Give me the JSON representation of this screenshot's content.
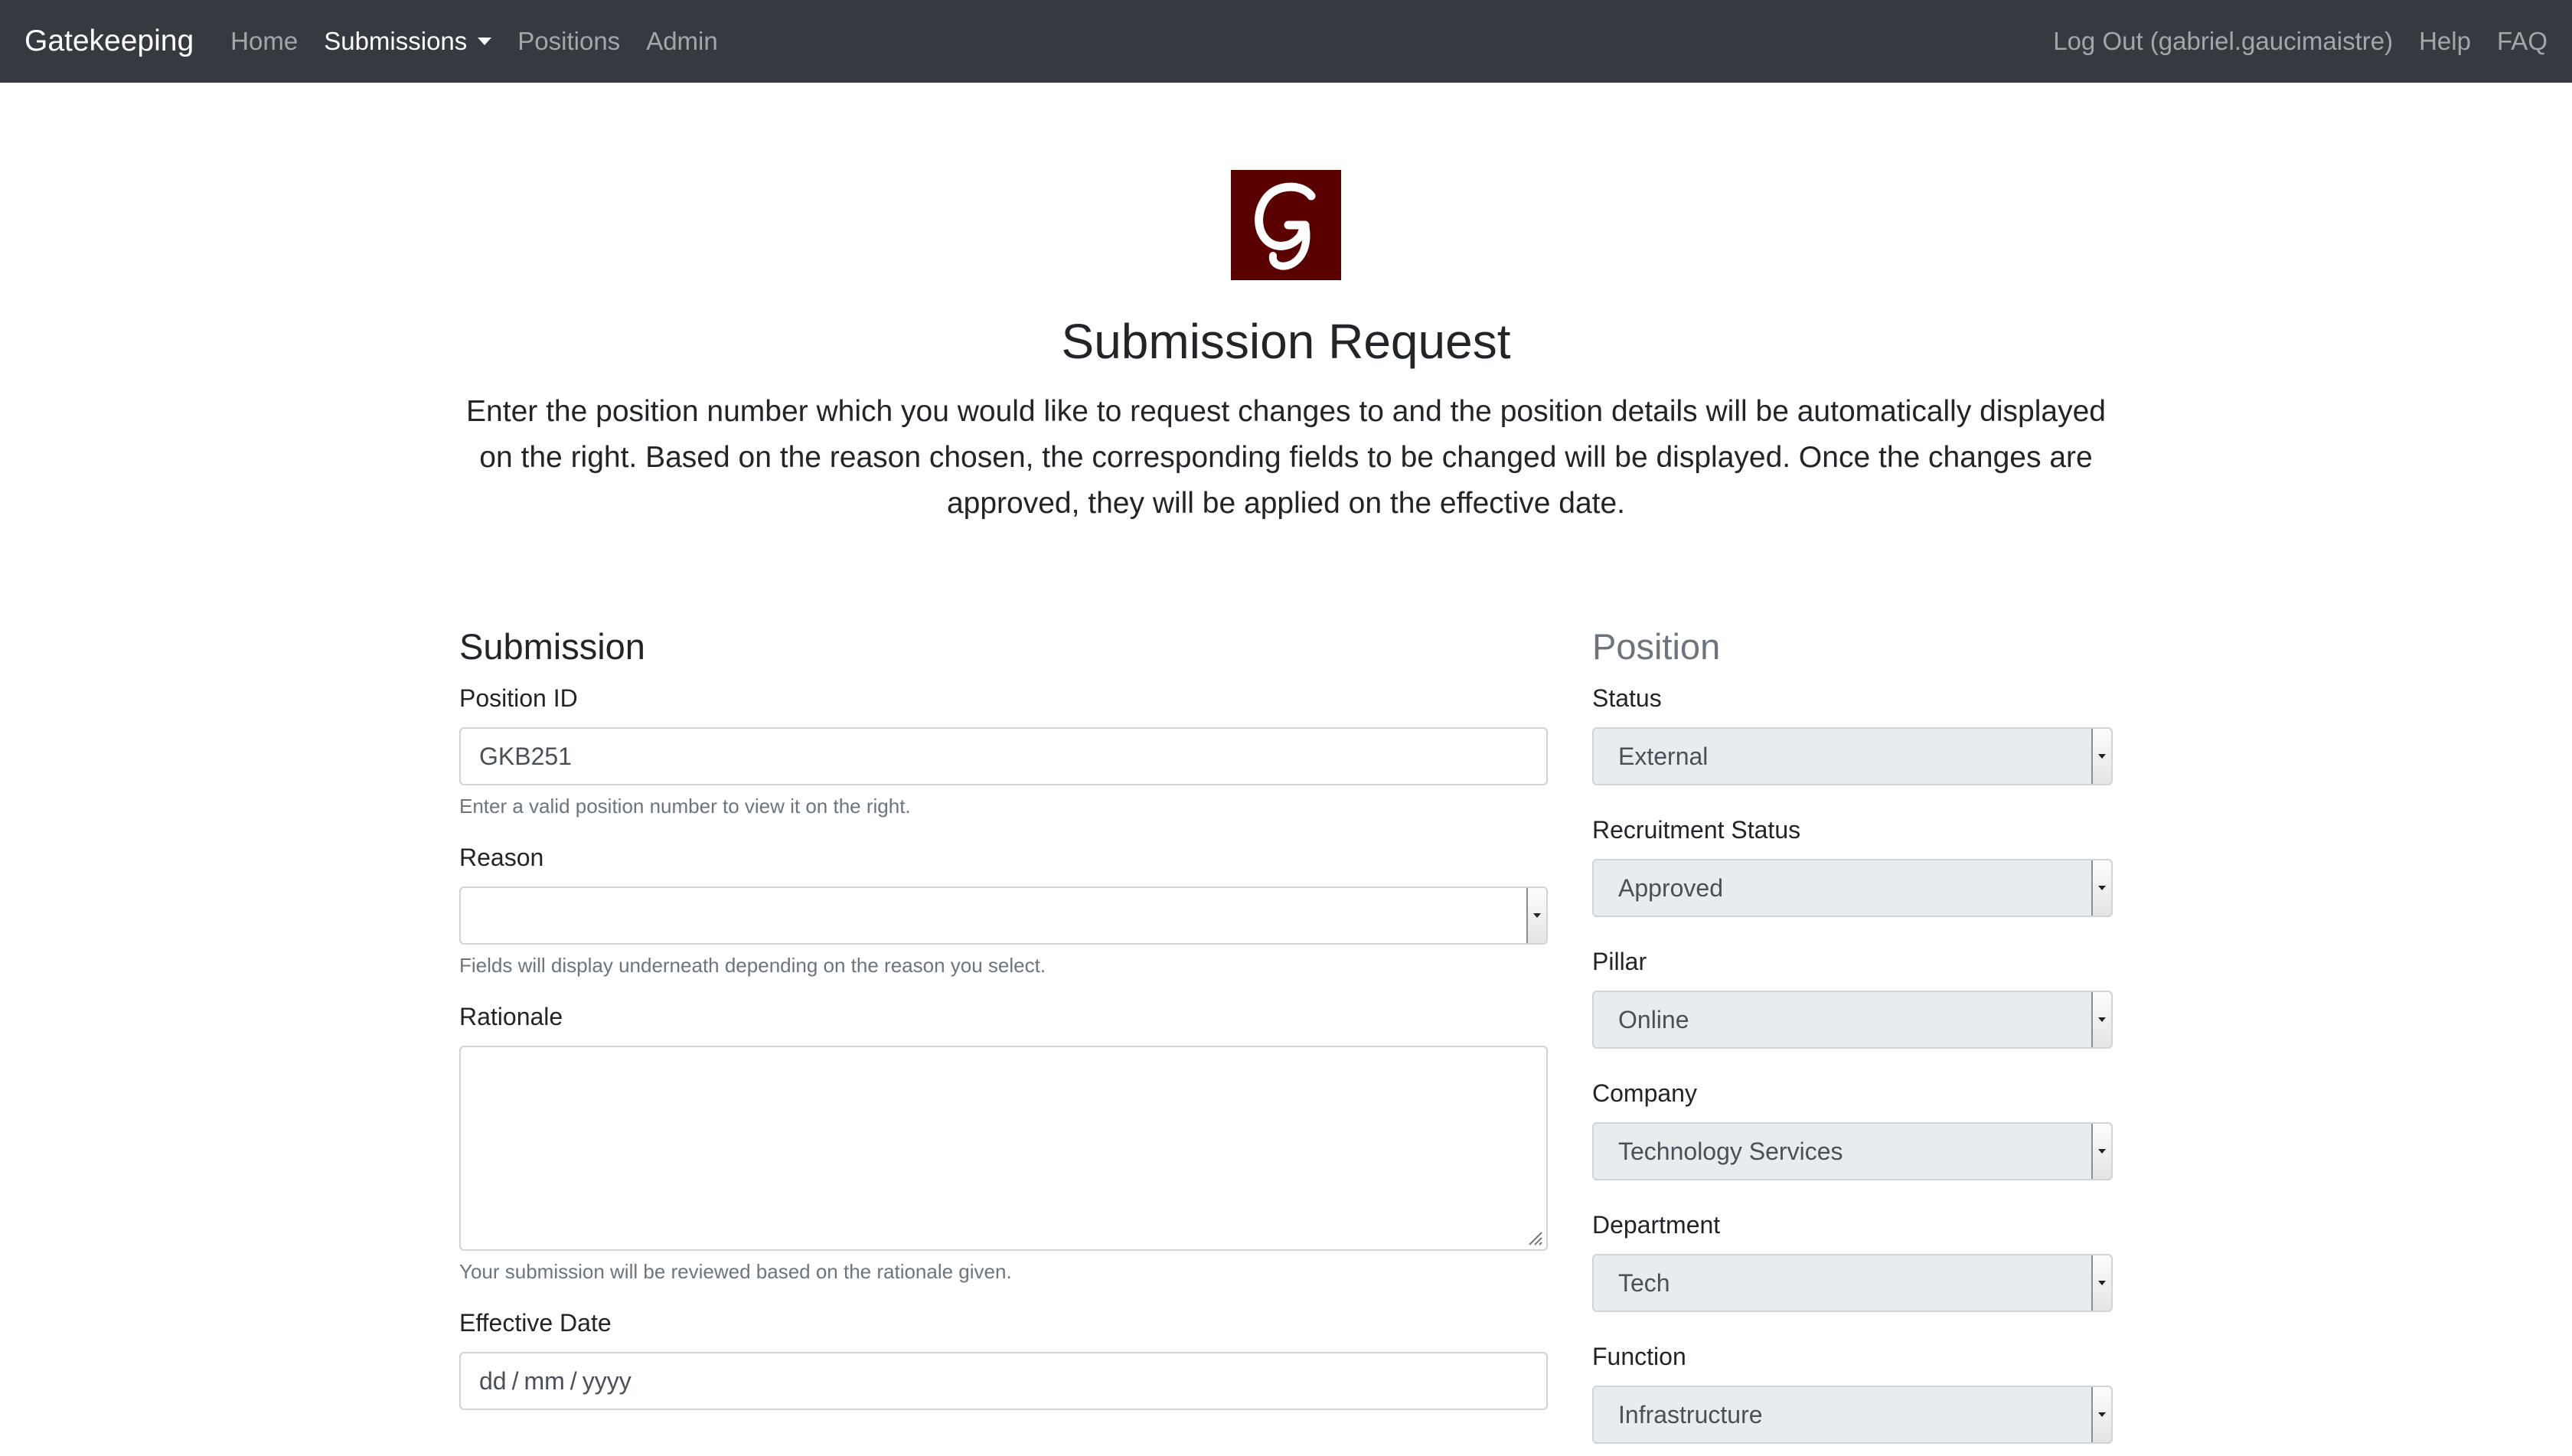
{
  "navbar": {
    "brand": "Gatekeeping",
    "items": [
      {
        "label": "Home"
      },
      {
        "label": "Submissions"
      },
      {
        "label": "Positions"
      },
      {
        "label": "Admin"
      }
    ],
    "right_items": [
      {
        "label": "Log Out (gabriel.gaucimaistre)"
      },
      {
        "label": "Help"
      },
      {
        "label": "FAQ"
      }
    ]
  },
  "logo": {
    "letter": "G",
    "icon": "brand-logo-icon",
    "color": "#5a0000"
  },
  "page": {
    "title": "Submission Request",
    "description": "Enter the position number which you would like to request changes to and the position details will be automatically displayed on the right. Based on the reason chosen, the corresponding fields to be changed will be displayed. Once the changes are approved, they will be applied on the effective date."
  },
  "submission": {
    "heading": "Submission",
    "position_id": {
      "label": "Position ID",
      "value": "GKB251",
      "help": "Enter a valid position number to view it on the right."
    },
    "reason": {
      "label": "Reason",
      "value": "",
      "help": "Fields will display underneath depending on the reason you select."
    },
    "rationale": {
      "label": "Rationale",
      "value": "",
      "help": "Your submission will be reviewed based on the rationale given."
    },
    "effective_date": {
      "label": "Effective Date",
      "day": "dd",
      "month": "mm",
      "year": "yyyy",
      "separator": "/"
    }
  },
  "position": {
    "heading": "Position",
    "fields": [
      {
        "label": "Status",
        "value": "External"
      },
      {
        "label": "Recruitment Status",
        "value": "Approved"
      },
      {
        "label": "Pillar",
        "value": "Online"
      },
      {
        "label": "Company",
        "value": "Technology Services"
      },
      {
        "label": "Department",
        "value": "Tech"
      },
      {
        "label": "Function",
        "value": "Infrastructure"
      }
    ]
  },
  "colors": {
    "navbar_bg": "#343a40",
    "readonly_bg": "#e9ecef",
    "muted_text": "#6c757d"
  }
}
